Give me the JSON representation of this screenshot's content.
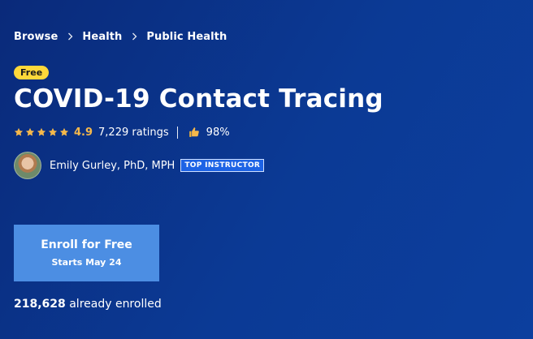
{
  "breadcrumb": {
    "items": [
      {
        "label": "Browse"
      },
      {
        "label": "Health"
      },
      {
        "label": "Public Health"
      }
    ]
  },
  "course": {
    "badge": "Free",
    "title": "COVID-19 Contact Tracing",
    "rating": {
      "stars": 5,
      "value": "4.9",
      "count": "7,229 ratings",
      "approval": "98%"
    },
    "instructor": {
      "name": "Emily Gurley, PhD, MPH",
      "badge": "TOP INSTRUCTOR"
    },
    "enroll": {
      "label": "Enroll for Free",
      "sublabel": "Starts May 24"
    },
    "enrolled": {
      "count": "218,628",
      "text": "already enrolled"
    }
  },
  "colors": {
    "background": "#0b3a95",
    "star": "#f5b84b",
    "free_badge": "#ffd83a",
    "enroll_button": "#4c8ee3",
    "top_instructor_badge": "#1d63e5"
  },
  "icons": {
    "breadcrumb_separator": "chevron-right-icon",
    "star": "star-icon",
    "thumb": "thumbs-up-icon",
    "avatar": "instructor-avatar"
  }
}
